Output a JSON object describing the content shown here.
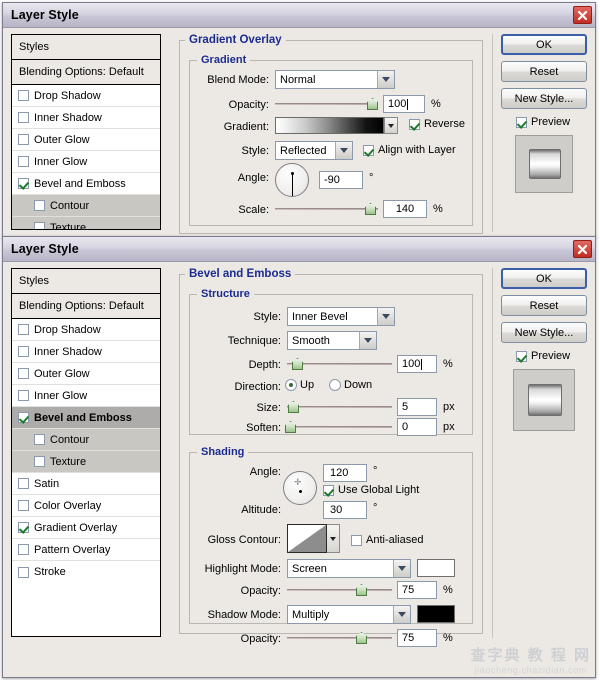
{
  "app": {
    "title": "Layer Style",
    "close_icon": "close-icon"
  },
  "dialog1": {
    "title": "Layer Style",
    "styles_panel": {
      "header": "Styles",
      "blending_options": "Blending Options: Default",
      "items": [
        {
          "label": "Drop Shadow",
          "checked": false,
          "sub": false,
          "selected": false
        },
        {
          "label": "Inner Shadow",
          "checked": false,
          "sub": false,
          "selected": false
        },
        {
          "label": "Outer Glow",
          "checked": false,
          "sub": false,
          "selected": false
        },
        {
          "label": "Inner Glow",
          "checked": false,
          "sub": false,
          "selected": false
        },
        {
          "label": "Bevel and Emboss",
          "checked": true,
          "sub": false,
          "selected": false
        },
        {
          "label": "Contour",
          "checked": false,
          "sub": true,
          "selected": false
        },
        {
          "label": "Texture",
          "checked": false,
          "sub": true,
          "selected": false
        }
      ]
    },
    "section_title": "Gradient Overlay",
    "group_title": "Gradient",
    "fields": {
      "blend_mode_label": "Blend Mode:",
      "blend_mode_value": "Normal",
      "opacity_label": "Opacity:",
      "opacity_value": "100",
      "opacity_unit": "%",
      "gradient_label": "Gradient:",
      "reverse_label": "Reverse",
      "reverse_checked": true,
      "style_label": "Style:",
      "style_value": "Reflected",
      "align_label": "Align with Layer",
      "align_checked": true,
      "angle_label": "Angle:",
      "angle_value": "-90",
      "angle_unit": "°",
      "scale_label": "Scale:",
      "scale_value": "140",
      "scale_unit": "%"
    },
    "buttons": {
      "ok": "OK",
      "reset": "Reset",
      "new_style": "New Style...",
      "preview_label": "Preview",
      "preview_checked": true
    }
  },
  "dialog2": {
    "title": "Layer Style",
    "styles_panel": {
      "header": "Styles",
      "blending_options": "Blending Options: Default",
      "items": [
        {
          "label": "Drop Shadow",
          "checked": false,
          "sub": false,
          "selected": false
        },
        {
          "label": "Inner Shadow",
          "checked": false,
          "sub": false,
          "selected": false
        },
        {
          "label": "Outer Glow",
          "checked": false,
          "sub": false,
          "selected": false
        },
        {
          "label": "Inner Glow",
          "checked": false,
          "sub": false,
          "selected": false
        },
        {
          "label": "Bevel and Emboss",
          "checked": true,
          "sub": false,
          "selected": true
        },
        {
          "label": "Contour",
          "checked": false,
          "sub": true,
          "selected": false
        },
        {
          "label": "Texture",
          "checked": false,
          "sub": true,
          "selected": false
        },
        {
          "label": "Satin",
          "checked": false,
          "sub": false,
          "selected": false
        },
        {
          "label": "Color Overlay",
          "checked": false,
          "sub": false,
          "selected": false
        },
        {
          "label": "Gradient Overlay",
          "checked": true,
          "sub": false,
          "selected": false
        },
        {
          "label": "Pattern Overlay",
          "checked": false,
          "sub": false,
          "selected": false
        },
        {
          "label": "Stroke",
          "checked": false,
          "sub": false,
          "selected": false
        }
      ]
    },
    "section_title": "Bevel and Emboss",
    "structure": {
      "group_title": "Structure",
      "style_label": "Style:",
      "style_value": "Inner Bevel",
      "technique_label": "Technique:",
      "technique_value": "Smooth",
      "depth_label": "Depth:",
      "depth_value": "100",
      "depth_unit": "%",
      "direction_label": "Direction:",
      "direction_up": "Up",
      "direction_down": "Down",
      "direction_selected": "Up",
      "size_label": "Size:",
      "size_value": "5",
      "size_unit": "px",
      "soften_label": "Soften:",
      "soften_value": "0",
      "soften_unit": "px"
    },
    "shading": {
      "group_title": "Shading",
      "angle_label": "Angle:",
      "angle_value": "120",
      "angle_unit": "°",
      "global_light_label": "Use Global Light",
      "global_light_checked": true,
      "altitude_label": "Altitude:",
      "altitude_value": "30",
      "altitude_unit": "°",
      "gloss_contour_label": "Gloss Contour:",
      "anti_aliased_label": "Anti-aliased",
      "anti_aliased_checked": false,
      "highlight_mode_label": "Highlight Mode:",
      "highlight_mode_value": "Screen",
      "highlight_color": "#ffffff",
      "highlight_opacity_label": "Opacity:",
      "highlight_opacity_value": "75",
      "highlight_opacity_unit": "%",
      "shadow_mode_label": "Shadow Mode:",
      "shadow_mode_value": "Multiply",
      "shadow_color": "#000000",
      "shadow_opacity_label": "Opacity:",
      "shadow_opacity_value": "75",
      "shadow_opacity_unit": "%"
    },
    "buttons": {
      "ok": "OK",
      "reset": "Reset",
      "new_style": "New Style...",
      "preview_label": "Preview",
      "preview_checked": true
    }
  },
  "watermark": {
    "line1": "查字典 教 程 网",
    "line2": "jiaocheng.chazidian.com"
  }
}
